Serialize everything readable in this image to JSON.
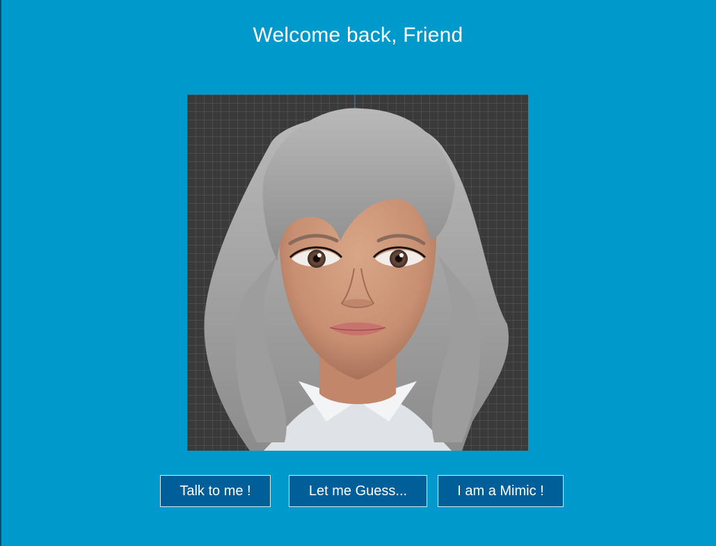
{
  "header": {
    "title": "Welcome back, Friend"
  },
  "avatar": {
    "icon": "avatar-portrait-icon"
  },
  "buttons": {
    "talk_label": "Talk to me !",
    "guess_label": "Let me Guess...",
    "mimic_label": "I am a Mimic !"
  },
  "colors": {
    "background": "#0099cc",
    "button_fill": "#005f99",
    "viewport": "#3a3a3a"
  }
}
